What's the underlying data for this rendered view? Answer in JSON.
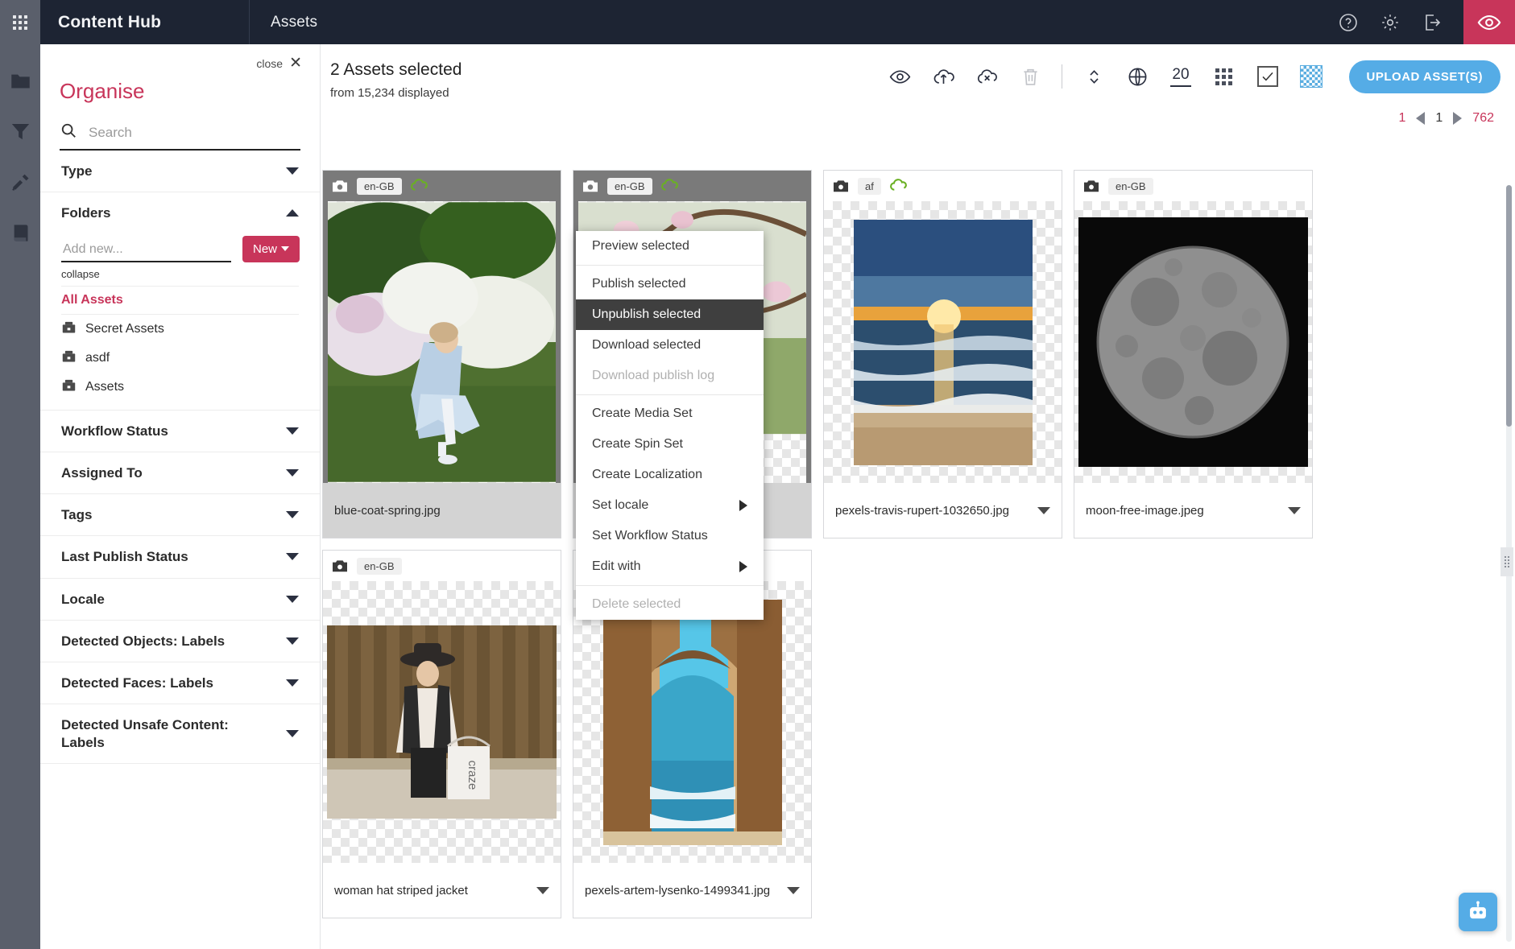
{
  "topbar": {
    "apps_icon": "apps-grid-icon",
    "brand": "Content Hub",
    "module": "Assets",
    "help_icon": "help-circle-icon",
    "settings_icon": "gear-icon",
    "logout_icon": "logout-icon",
    "preview_icon": "eye-icon",
    "accent_dark": "#1d2433",
    "accent_pink": "#c8355a"
  },
  "rail": {
    "items": [
      {
        "icon": "folder-icon",
        "name": "folders"
      },
      {
        "icon": "filter-funnel-icon",
        "name": "filters"
      },
      {
        "icon": "tools-icon",
        "name": "tools"
      },
      {
        "icon": "book-icon",
        "name": "library"
      }
    ]
  },
  "organise": {
    "close_label": "close",
    "close_icon": "close-x-icon",
    "title": "Organise",
    "search": {
      "placeholder": "Search",
      "value": "",
      "icon": "search-icon"
    },
    "facets": [
      {
        "label": "Type",
        "expanded": false
      },
      {
        "label": "Folders",
        "expanded": true
      },
      {
        "label": "Workflow Status",
        "expanded": false
      },
      {
        "label": "Assigned To",
        "expanded": false
      },
      {
        "label": "Tags",
        "expanded": false
      },
      {
        "label": "Last Publish Status",
        "expanded": false
      },
      {
        "label": "Locale",
        "expanded": false
      },
      {
        "label": "Detected Objects: Labels",
        "expanded": false
      },
      {
        "label": "Detected Faces: Labels",
        "expanded": false
      },
      {
        "label": "Detected Unsafe Content: Labels",
        "expanded": false
      }
    ],
    "folders": {
      "add_placeholder": "Add new...",
      "add_value": "",
      "new_button": "New",
      "collapse_link": "collapse",
      "all_assets": "All Assets",
      "items": [
        {
          "label": "Secret Assets",
          "icon": "folder-box-icon"
        },
        {
          "label": "asdf",
          "icon": "folder-box-icon"
        },
        {
          "label": "Assets",
          "icon": "folder-box-icon"
        }
      ]
    }
  },
  "main": {
    "selected_title": "2 Assets selected",
    "selected_sub": "from 15,234 displayed",
    "toolbar": [
      {
        "name": "preview-selected-icon",
        "icon": "eye-icon",
        "disabled": false
      },
      {
        "name": "publish-selected-icon",
        "icon": "cloud-upload-icon",
        "disabled": false
      },
      {
        "name": "unpublish-selected-icon",
        "icon": "cloud-x-icon",
        "disabled": false
      },
      {
        "name": "delete-selected-icon",
        "icon": "trash-icon",
        "disabled": true
      },
      {
        "name": "sort-icon",
        "icon": "sort-updown-icon",
        "disabled": false
      },
      {
        "name": "locale-icon",
        "icon": "globe-icon",
        "disabled": false
      }
    ],
    "page_size": "20",
    "grid_view_icon": "grid-view-icon",
    "select_all_icon": "checkbox-checked-icon",
    "transparency_icon": "transparency-checker-icon",
    "upload_button": "UPLOAD ASSET(S)",
    "pager": {
      "first": "1",
      "prev_icon": "arrow-left-icon",
      "current": "1",
      "next_icon": "arrow-right-icon",
      "last": "762"
    }
  },
  "assets": [
    {
      "locale": "en-GB",
      "filename": "blue-coat-spring.jpg",
      "selected": true,
      "published": true,
      "kind": "girl-blue-coat-garden",
      "show_chevron": false
    },
    {
      "locale": "en-GB",
      "filename": "",
      "selected": true,
      "published": true,
      "kind": "woman-blossom-branch",
      "show_chevron": false
    },
    {
      "locale": "af",
      "filename": "pexels-travis-rupert-1032650.jpg",
      "selected": false,
      "published": true,
      "kind": "beach-sunset",
      "show_chevron": true
    },
    {
      "locale": "en-GB",
      "filename": "moon-free-image.jpeg",
      "selected": false,
      "published": false,
      "kind": "moon",
      "show_chevron": true
    },
    {
      "locale": "en-GB",
      "filename": "woman hat striped jacket",
      "selected": false,
      "published": false,
      "kind": "woman-hat-bag",
      "show_chevron": true
    },
    {
      "locale": "en-GB",
      "filename": "pexels-artem-lysenko-1499341.jpg",
      "selected": false,
      "published": true,
      "kind": "rock-arch-sea",
      "show_chevron": true
    }
  ],
  "context_menu": {
    "items": [
      {
        "label": "Preview selected",
        "state": "normal",
        "submenu": false
      },
      {
        "label": "Publish selected",
        "state": "normal",
        "submenu": false
      },
      {
        "label": "Unpublish selected",
        "state": "highlight",
        "submenu": false
      },
      {
        "label": "Download selected",
        "state": "normal",
        "submenu": false
      },
      {
        "label": "Download publish log",
        "state": "disabled",
        "submenu": false
      },
      {
        "label": "Create Media Set",
        "state": "normal",
        "submenu": false
      },
      {
        "label": "Create Spin Set",
        "state": "normal",
        "submenu": false
      },
      {
        "label": "Create Localization",
        "state": "normal",
        "submenu": false
      },
      {
        "label": "Set locale",
        "state": "normal",
        "submenu": true
      },
      {
        "label": "Set Workflow Status",
        "state": "normal",
        "submenu": false
      },
      {
        "label": "Edit with",
        "state": "normal",
        "submenu": true
      },
      {
        "label": "Delete selected",
        "state": "disabled",
        "submenu": false
      }
    ]
  },
  "chatbot": {
    "icon": "robot-chat-icon"
  }
}
